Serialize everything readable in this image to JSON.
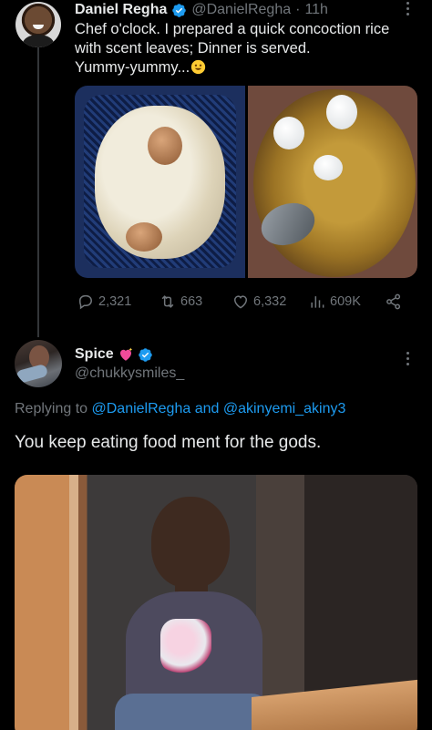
{
  "tweet": {
    "author_name": "Daniel Regha",
    "handle": "@DanielRegha",
    "separator": "·",
    "time": "11h",
    "text_lines": [
      "Chef o'clock. I prepared a quick concoction rice",
      "with scent leaves; Dinner is served.",
      "Yummy-yummy..."
    ],
    "stats": {
      "replies": "2,321",
      "reposts": "663",
      "likes": "6,332",
      "views": "609K"
    }
  },
  "reply": {
    "author_name": "Spice",
    "handle": "@chukkysmiles_",
    "replying_prefix": "Replying to",
    "replying_user1": "@DanielRegha",
    "replying_and": "and",
    "replying_user2": "@akinyemi_akiny3",
    "text": "You keep eating food ment for the gods."
  },
  "colors": {
    "background": "#000000",
    "text": "#e7e9ea",
    "muted": "#71767b",
    "link": "#1d9bf0",
    "verified": "#1d9bf0"
  },
  "icons": [
    "verified-icon",
    "more-icon",
    "reply-icon",
    "repost-icon",
    "like-icon",
    "views-icon",
    "share-icon"
  ]
}
